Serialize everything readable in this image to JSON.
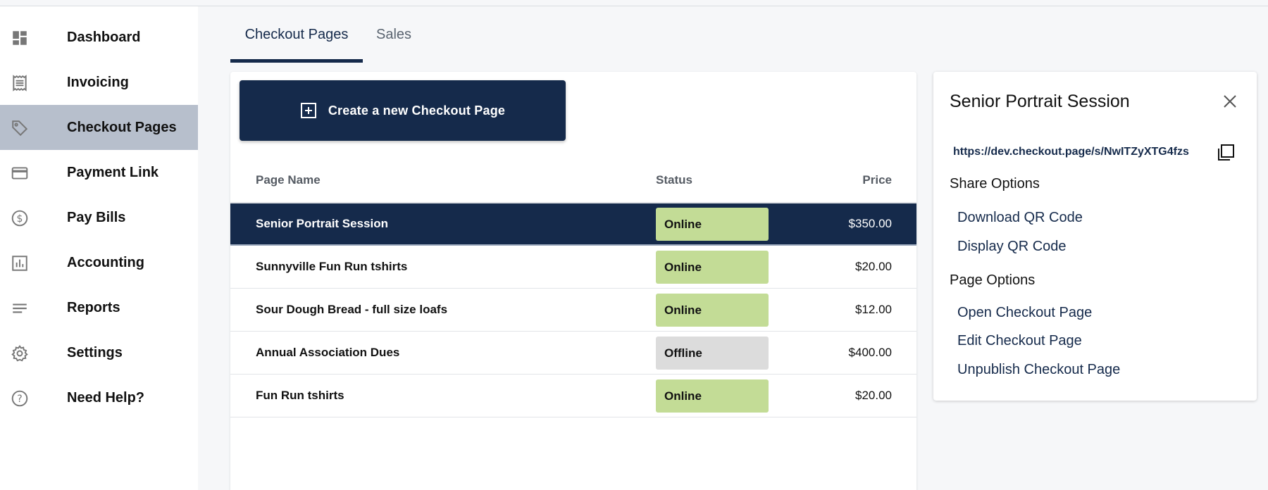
{
  "sidebar": {
    "items": [
      {
        "label": "Dashboard",
        "icon": "dashboard-icon"
      },
      {
        "label": "Invoicing",
        "icon": "receipt-icon"
      },
      {
        "label": "Checkout Pages",
        "icon": "tag-icon",
        "active": true
      },
      {
        "label": "Payment Link",
        "icon": "credit-card-icon"
      },
      {
        "label": "Pay Bills",
        "icon": "dollar-circle-icon"
      },
      {
        "label": "Accounting",
        "icon": "bar-chart-icon"
      },
      {
        "label": "Reports",
        "icon": "lines-icon"
      },
      {
        "label": "Settings",
        "icon": "gear-icon"
      },
      {
        "label": "Need Help?",
        "icon": "help-circle-icon"
      }
    ]
  },
  "tabs": [
    {
      "label": "Checkout Pages",
      "active": true
    },
    {
      "label": "Sales",
      "active": false
    }
  ],
  "main": {
    "create_button_label": "Create a new Checkout Page",
    "columns": {
      "name": "Page Name",
      "status": "Status",
      "price": "Price"
    },
    "rows": [
      {
        "name": "Senior Portrait Session",
        "status": "Online",
        "price": "$350.00",
        "selected": true
      },
      {
        "name": "Sunnyville Fun Run tshirts",
        "status": "Online",
        "price": "$20.00"
      },
      {
        "name": "Sour Dough Bread - full size loafs",
        "status": "Online",
        "price": "$12.00"
      },
      {
        "name": "Annual Association Dues",
        "status": "Offline",
        "price": "$400.00"
      },
      {
        "name": "Fun Run tshirts",
        "status": "Online",
        "price": "$20.00"
      }
    ]
  },
  "panel": {
    "title": "Senior Portrait Session",
    "url": "https://dev.checkout.page/s/NwITZyXTG4fzs",
    "share_heading": "Share Options",
    "share_links": [
      "Download QR Code",
      "Display QR Code"
    ],
    "page_heading": "Page Options",
    "page_links": [
      "Open Checkout Page",
      "Edit Checkout Page",
      "Unpublish Checkout Page"
    ]
  },
  "colors": {
    "brand_navy": "#152a4b",
    "online_badge": "#c3dc96",
    "offline_badge": "#dcdcdc",
    "active_nav": "#b7bfcc"
  }
}
